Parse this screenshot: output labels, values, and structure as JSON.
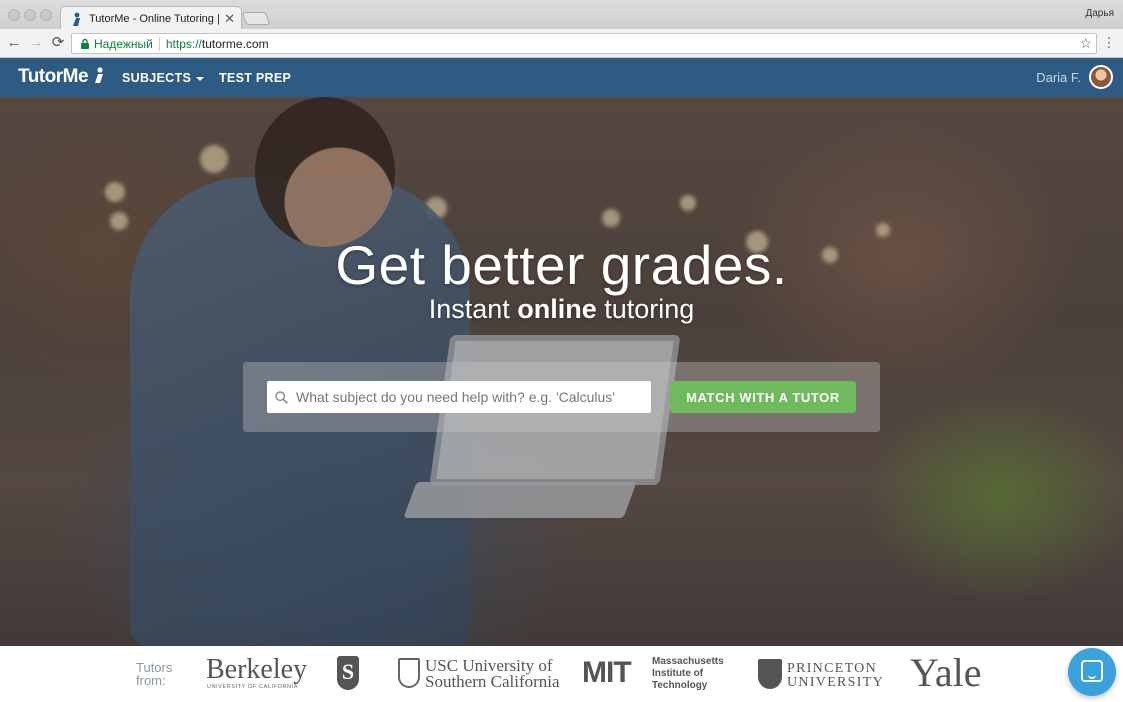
{
  "browser": {
    "tab_title": "TutorMe - Online Tutoring | Or",
    "profile_name": "Дарья",
    "security_label": "Надежный",
    "url_scheme": "https://",
    "url_host": "tutorme.com"
  },
  "nav": {
    "logo": "TutorMe",
    "subjects": "SUBJECTS",
    "test_prep": "TEST PREP",
    "user_name": "Daria F."
  },
  "hero": {
    "headline": "Get better grades.",
    "subline_pre": "Instant ",
    "subline_bold": "online",
    "subline_post": " tutoring",
    "search_placeholder": "What subject do you need help with? e.g. 'Calculus'",
    "match_button": "MATCH WITH A TUTOR"
  },
  "logos": {
    "tutors_from_1": "Tutors",
    "tutors_from_2": "from:",
    "berkeley": "Berkeley",
    "berkeley_sub": "UNIVERSITY OF CALIFORNIA",
    "stanford": "S",
    "usc_line1": "USC University of",
    "usc_line2": "Southern California",
    "mit_mark": "MIT",
    "mit_line1": "Massachusetts",
    "mit_line2": "Institute of",
    "mit_line3": "Technology",
    "princeton_line1": "PRINCETON",
    "princeton_line2": "UNIVERSITY",
    "yale": "Yale"
  },
  "colors": {
    "nav_bg": "#2e5b83",
    "match_button": "#6fba5c",
    "chat_bubble": "#3aa2db"
  }
}
